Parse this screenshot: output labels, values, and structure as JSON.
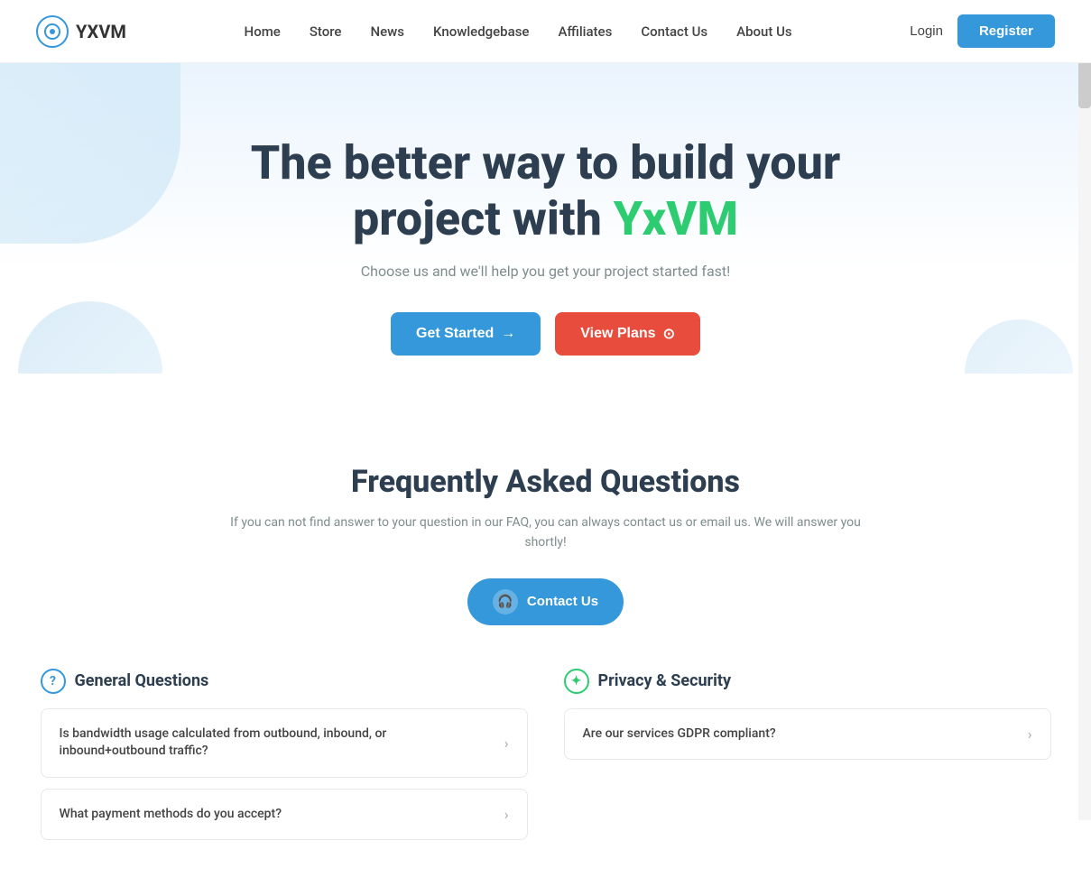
{
  "nav": {
    "logo_text": "YXVM",
    "links": [
      {
        "label": "Home",
        "name": "home"
      },
      {
        "label": "Store",
        "name": "store"
      },
      {
        "label": "News",
        "name": "news"
      },
      {
        "label": "Knowledgebase",
        "name": "knowledgebase"
      },
      {
        "label": "Affiliates",
        "name": "affiliates"
      },
      {
        "label": "Contact Us",
        "name": "contact-us"
      },
      {
        "label": "About Us",
        "name": "about-us"
      }
    ],
    "login_label": "Login",
    "register_label": "Register"
  },
  "hero": {
    "headline_part1": "The better way to build your",
    "headline_part2": "project with ",
    "headline_brand": "YxVM",
    "subtitle": "Choose us and we'll help you get your project started fast!",
    "btn_get_started": "Get Started",
    "btn_view_plans": "View Plans"
  },
  "faq": {
    "title": "Frequently Asked Questions",
    "description": "If you can not find answer to your question in our FAQ, you can always contact us or email us. We will answer you shortly!",
    "contact_btn_label": "Contact Us",
    "columns": [
      {
        "icon": "?",
        "header": "General Questions",
        "items": [
          {
            "text": "Is bandwidth usage calculated from outbound, inbound, or inbound+outbound traffic?"
          },
          {
            "text": "What payment methods do you accept?"
          }
        ]
      },
      {
        "icon": "🛡",
        "header": "Privacy & Security",
        "items": [
          {
            "text": "Are our services GDPR compliant?"
          }
        ]
      }
    ]
  },
  "colors": {
    "brand_blue": "#3498db",
    "brand_green": "#2ecc71",
    "brand_red": "#e74c3c",
    "text_dark": "#2c3e50",
    "text_muted": "#7f8c8d"
  }
}
